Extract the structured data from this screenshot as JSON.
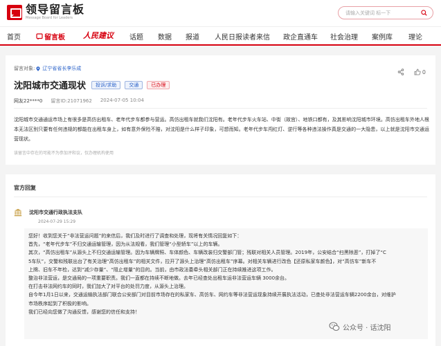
{
  "header": {
    "logo_cn": "领导留言板",
    "logo_en": "Message Board for Leaders",
    "search_placeholder": "请输入关键词 标一下"
  },
  "nav": {
    "items": [
      "首页",
      "留言板",
      "话题",
      "数据",
      "报道",
      "人民日报读者来信",
      "政企直通车",
      "社会治理",
      "案例库",
      "理论"
    ],
    "brand": "人民建议"
  },
  "message": {
    "target_label": "留言对象:",
    "target_value": "辽宁省省长李乐成",
    "title": "沈阳城市交通现状",
    "tags": [
      "投诉/求助",
      "交通",
      "已办理"
    ],
    "like_count": "0",
    "user": "网友22****0",
    "message_id": "留言ID:21071962",
    "time": "2024-07-05 10:04",
    "body_1": "沈阳城市交通通运市场上有很多是高仿出租车、老年代步车都参与营运。高仿出租车就我们沈阳有。老年代步车火车站、中街（故宫）、地铁口都有，及其影响沈阳城市环境。高仿出租车外地人根本无法区别只要有任何违规的都能在出租车身上，如有意外保险不赔，对沈阳是什么样子印象，可想而知。老年代步车闯红灯、逆行等各种违法操作真是交通的一大隐患，以上就是沈阳市交通运营现状。",
    "note": "该留言中存在的可能不为参加评和议，仅办理机构使用"
  },
  "reply": {
    "section_title": "官方回复",
    "org": "沈阳市交通行政执法支队",
    "time": "2024-07-29 15:29",
    "lines": [
      "您好！收到您关于“非法营运问题”的来信后，我们及时进行了调查和处理，现将有关情况回复如下：",
      "首先，“老年代步车”不归交通运输管理，因为从法规看，我们管理“小型轿车”以上的车辆。",
      "其次，“高仿出租车”从源头上不归交通运输管理。因为车辆牌照、车体颜色、车辆改装归交警部门管；残联对相关人员管理。2019年，公安结合“扫黑除恶”，打掉了“C",
      "5车队”，交警和残联出台了有关治理“高仿出租车”的相关文件，拉开了源头上治理“高仿出租车”序幕。对相关车辆进行改色【还原私家车颜色】，对“高仿车”新车不",
      "上牌、旧车不年检，达到“减少存量”、“阻止增量”的目的。当前，由市政法委牵头相关部门正在持续推进这项工作。",
      "整治非法营运，是交通局的一项重要职责。我们一直都在持续不断地做。去年已经查处出租车运非法营运车辆 3000余台。",
      "在打击非法网约车的同时，我们加大了对平台的处罚力度，从源头上治理。",
      "自今年1月1日以来，交通运输执法部门联合公安部门对目前市场存在的私家车、高仿车、网约车等非法营运现象持续开展执法活动，已查处非法营运车辆2200余台，对维护",
      "市场秩序起到了积极的影响。",
      "我们已经向您做了沟通反馈，感谢您的信任和支持！"
    ]
  },
  "watermark": {
    "text": "公众号 · 话沈阳"
  }
}
